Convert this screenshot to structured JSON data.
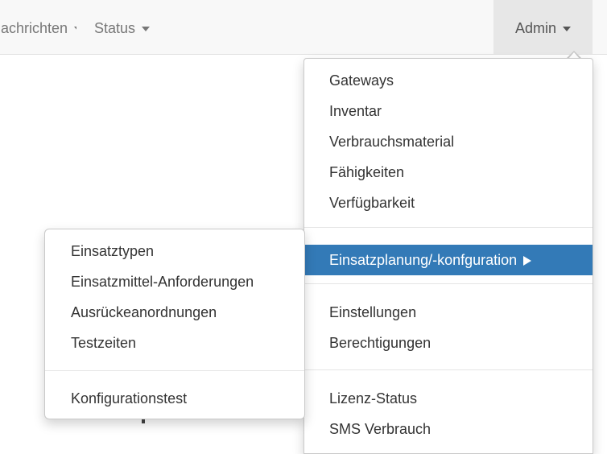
{
  "navbar": {
    "items": [
      {
        "label": "Nachrichten",
        "has_caret": true
      },
      {
        "label": "Status",
        "has_caret": true
      },
      {
        "label": "Admin",
        "has_caret": true,
        "open": true
      }
    ]
  },
  "admin_menu": {
    "groups": [
      [
        "Gateways",
        "Inventar",
        "Verbrauchsmaterial",
        "Fähigkeiten",
        "Verfügbarkeit"
      ],
      [
        "Einsatzplanung/-konfguration"
      ],
      [
        "Einstellungen",
        "Berechtigungen"
      ],
      [
        "Lizenz-Status",
        "SMS Verbrauch"
      ]
    ],
    "active_item": "Einsatzplanung/-konfguration",
    "active_has_submenu_arrow": true
  },
  "submenu": {
    "groups": [
      [
        "Einsatztypen",
        "Einsatzmittel-Anforderungen",
        "Ausrückeanordnungen",
        "Testzeiten"
      ],
      [
        "Konfigurationstest"
      ]
    ]
  },
  "colors": {
    "navbar_bg": "#f8f8f8",
    "active_nav_bg": "#e7e7e7",
    "active_item_bg": "#337ab7",
    "active_item_text": "#ffffff",
    "text": "#333333",
    "nav_text": "#777777"
  },
  "icons": {
    "nav_caret": "caret-down-icon",
    "submenu_arrow": "triangle-right-icon"
  }
}
